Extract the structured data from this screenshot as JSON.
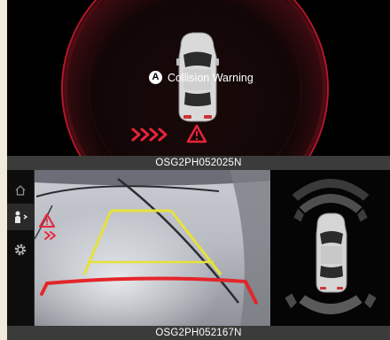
{
  "figures": [
    {
      "caption": "OSG2PH052025N",
      "callout_letter": "A",
      "warning_text": "Collision Warning"
    },
    {
      "caption": "OSG2PH052167N"
    }
  ],
  "colors": {
    "warning_red": "#e8243a",
    "guide_yellow": "#e6e23a",
    "guide_red": "#e3262a",
    "sensor_gray": "#5a5a5a"
  },
  "icons": {
    "nav": [
      "home-icon",
      "parking-assist-icon",
      "settings-icon"
    ],
    "warnings": [
      "warning-triangle-icon",
      "chevron-arrows-icon"
    ]
  }
}
